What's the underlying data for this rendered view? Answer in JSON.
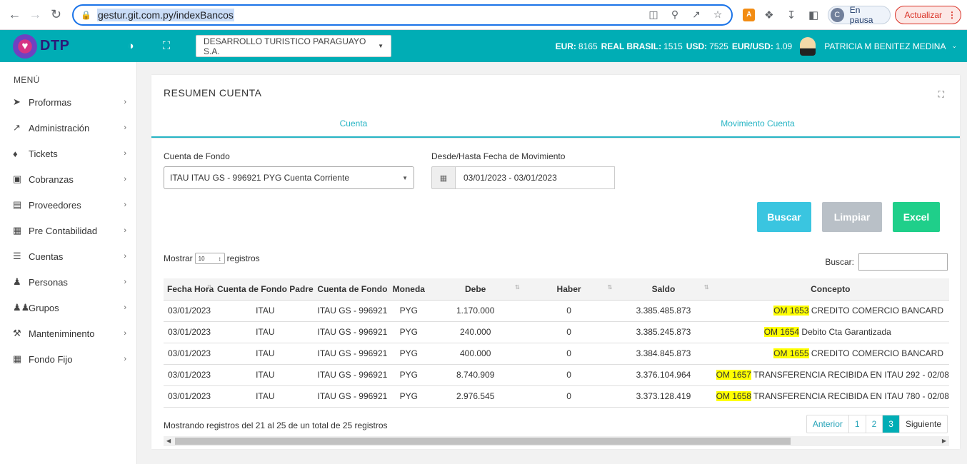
{
  "browser": {
    "url": "gestur.git.com.py/indexBancos",
    "profile_initial": "C",
    "profile_status": "En pausa",
    "update_label": "Actualizar"
  },
  "header": {
    "logo_text": "DTP",
    "company": "DESARROLLO TURISTICO PARAGUAYO S.A.",
    "rates": [
      {
        "label": "EUR:",
        "value": "8165"
      },
      {
        "label": "REAL BRASIL:",
        "value": "1515"
      },
      {
        "label": "USD:",
        "value": "7525"
      },
      {
        "label": "EUR/USD:",
        "value": "1.09"
      }
    ],
    "user_name": "PATRICIA M BENITEZ MEDINA"
  },
  "sidebar": {
    "title": "MENÚ",
    "items": [
      {
        "label": "Proformas",
        "icon": "paper-plane-icon"
      },
      {
        "label": "Administración",
        "icon": "line-chart-icon"
      },
      {
        "label": "Tickets",
        "icon": "ticket-icon"
      },
      {
        "label": "Cobranzas",
        "icon": "money-icon"
      },
      {
        "label": "Proveedores",
        "icon": "address-card-icon"
      },
      {
        "label": "Pre Contabilidad",
        "icon": "calculator-icon"
      },
      {
        "label": "Cuentas",
        "icon": "list-icon"
      },
      {
        "label": "Personas",
        "icon": "user-icon"
      },
      {
        "label": "Grupos",
        "icon": "users-icon"
      },
      {
        "label": "Manteniminento",
        "icon": "wrench-icon"
      },
      {
        "label": "Fondo Fijo",
        "icon": "calculator-icon"
      }
    ]
  },
  "card": {
    "title": "RESUMEN CUENTA",
    "tabs": [
      "Cuenta",
      "Movimiento Cuenta"
    ]
  },
  "filters": {
    "cuenta_label": "Cuenta de Fondo",
    "cuenta_value": "ITAU ITAU GS - 996921 PYG Cuenta Corriente",
    "fecha_label": "Desde/Hasta Fecha de Movimiento",
    "fecha_value": "03/01/2023 - 03/01/2023"
  },
  "buttons": {
    "buscar": "Buscar",
    "limpiar": "Limpiar",
    "excel": "Excel"
  },
  "table_controls": {
    "show_prefix": "Mostrar",
    "show_value": "10",
    "show_suffix": "registros",
    "search_label": "Buscar:"
  },
  "table": {
    "columns": [
      "Fecha Hora",
      "Cuenta de Fondo Padre",
      "Cuenta de Fondo",
      "Moneda",
      "Debe",
      "Haber",
      "Saldo",
      "Concepto"
    ],
    "rows": [
      {
        "fecha": "03/01/2023",
        "padre": "ITAU",
        "cuenta": "ITAU GS - 996921",
        "moneda": "PYG",
        "debe": "1.170.000",
        "haber": "0",
        "saldo": "3.385.485.873",
        "om": "OM 1653",
        "concepto": "CREDITO COMERCIO BANCARD"
      },
      {
        "fecha": "03/01/2023",
        "padre": "ITAU",
        "cuenta": "ITAU GS - 996921",
        "moneda": "PYG",
        "debe": "240.000",
        "haber": "0",
        "saldo": "3.385.245.873",
        "om": "OM 1654",
        "concepto": "Debito Cta Garantizada"
      },
      {
        "fecha": "03/01/2023",
        "padre": "ITAU",
        "cuenta": "ITAU GS - 996921",
        "moneda": "PYG",
        "debe": "400.000",
        "haber": "0",
        "saldo": "3.384.845.873",
        "om": "OM 1655",
        "concepto": "CREDITO COMERCIO BANCARD"
      },
      {
        "fecha": "03/01/2023",
        "padre": "ITAU",
        "cuenta": "ITAU GS - 996921",
        "moneda": "PYG",
        "debe": "8.740.909",
        "haber": "0",
        "saldo": "3.376.104.964",
        "om": "OM 1657",
        "concepto": "TRANSFERENCIA RECIBIDA EN ITAU 292 - 02/08"
      },
      {
        "fecha": "03/01/2023",
        "padre": "ITAU",
        "cuenta": "ITAU GS - 996921",
        "moneda": "PYG",
        "debe": "2.976.545",
        "haber": "0",
        "saldo": "3.373.128.419",
        "om": "OM 1658",
        "concepto": "TRANSFERENCIA RECIBIDA EN ITAU 780 - 02/08"
      }
    ]
  },
  "pagination": {
    "info": "Mostrando registros del 21 al 25 de un total de 25 registros",
    "prev": "Anterior",
    "pages": [
      "1",
      "2",
      "3"
    ],
    "active_page": "3",
    "next": "Siguiente"
  }
}
